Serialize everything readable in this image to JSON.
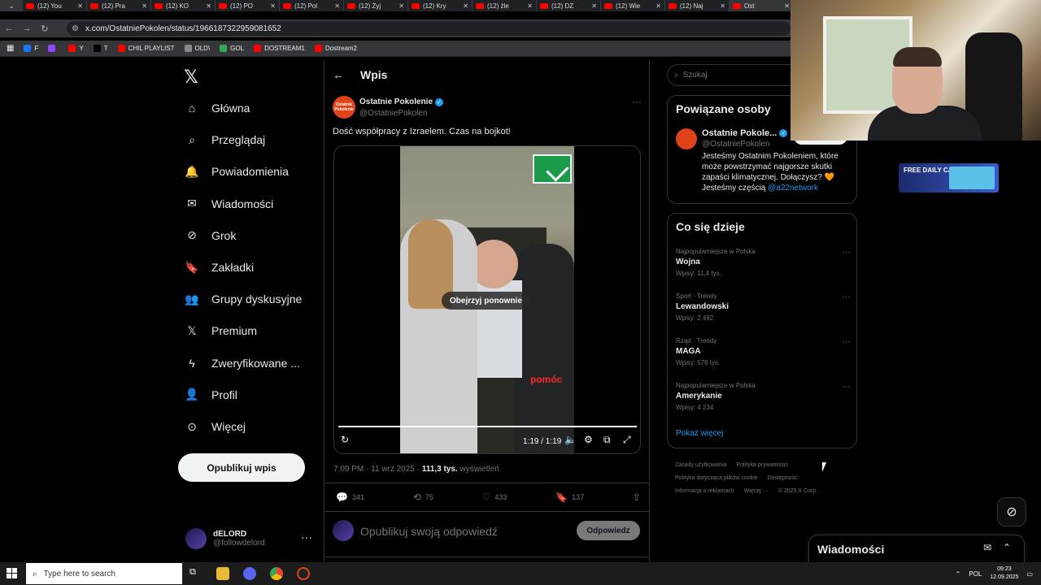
{
  "browser": {
    "tabs": [
      {
        "label": "(12) You"
      },
      {
        "label": "(12) Pra"
      },
      {
        "label": "(12) KO"
      },
      {
        "label": "(12) PO"
      },
      {
        "label": "(12) Pol"
      },
      {
        "label": "(12) Żyj"
      },
      {
        "label": "(12) Kry"
      },
      {
        "label": "(12) źle"
      },
      {
        "label": "(12) DZ"
      },
      {
        "label": "(12) Wie"
      },
      {
        "label": "(12) Naj"
      },
      {
        "label": "Ost"
      }
    ],
    "url": "x.com/OstatniePokolen/status/1966187322959081652",
    "bookmarks": [
      {
        "label": "F",
        "color": "#1877f2"
      },
      {
        "label": "",
        "color": "#9146ff"
      },
      {
        "label": "Y",
        "color": "#ff0000"
      },
      {
        "label": "T",
        "color": "#000000"
      },
      {
        "label": "CHIL PLAYLIST",
        "color": "#ff0000"
      },
      {
        "label": "OLD\\",
        "color": "#8a8a8a"
      },
      {
        "label": "GOL",
        "color": "#34a853"
      },
      {
        "label": "DOSTREAM1",
        "color": "#ff0000"
      },
      {
        "label": "Dostream2",
        "color": "#ff0000"
      }
    ]
  },
  "sidebar": {
    "items": [
      {
        "label": "Główna",
        "icon": "home-icon"
      },
      {
        "label": "Przeglądaj",
        "icon": "search-icon"
      },
      {
        "label": "Powiadomienia",
        "icon": "bell-icon"
      },
      {
        "label": "Wiadomości",
        "icon": "mail-icon"
      },
      {
        "label": "Grok",
        "icon": "grok-icon"
      },
      {
        "label": "Zakładki",
        "icon": "bookmark-icon"
      },
      {
        "label": "Grupy dyskusyjne",
        "icon": "people-icon"
      },
      {
        "label": "Premium",
        "icon": "x-icon"
      },
      {
        "label": "Zweryfikowane ...",
        "icon": "lightning-icon"
      },
      {
        "label": "Profil",
        "icon": "person-icon"
      },
      {
        "label": "Więcej",
        "icon": "more-circle-icon"
      }
    ],
    "post_button": "Opublikuj wpis",
    "user": {
      "name": "dELORD",
      "handle": "@followdelord"
    }
  },
  "post": {
    "header": "Wpis",
    "author_name": "Ostatnie Pokolenie",
    "author_handle": "@OstatniePokolen",
    "avatar_text": "Ostatnie Pokolenie",
    "text": "Dość współpracy z Izraelem. Czas na bojkot!",
    "video": {
      "replay_label": "Obejrzyj ponownie",
      "overlay_text": "pomóc",
      "time": "1:19 / 1:19"
    },
    "meta_time": "7:09 PM · 11 wrz 2025 · ",
    "meta_views": "111,3 tys.",
    "meta_views_label": " wyświetleń",
    "stats": {
      "replies": "341",
      "reposts": "75",
      "likes": "433",
      "bookmarks": "137"
    },
    "reply_placeholder": "Opublikuj swoją odpowiedź",
    "reply_button": "Odpowiedz"
  },
  "right": {
    "search_placeholder": "Szukaj",
    "related": {
      "title": "Powiązane osoby",
      "name": "Ostatnie Pokole...",
      "handle": "@OstatniePokolen",
      "follow": "Obserwuj",
      "bio": "Jesteśmy Ostatnim Pokoleniem, które może powstrzymać najgorsze skutki zapaści klimatycznej. Dołączysz? 🧡 Jesteśmy częścią ",
      "bio_link": "@a22network"
    },
    "trends": {
      "title": "Co się dzieje",
      "items": [
        {
          "context": "Najpopularniejsze w Polska",
          "title": "Wojna",
          "count": "Wpisy: 11,4 tys."
        },
        {
          "context": "Sport · Trendy",
          "title": "Lewandowski",
          "count": "Wpisy: 2 492"
        },
        {
          "context": "Rząd · Trendy",
          "title": "MAGA",
          "count": "Wpisy: 576 tys."
        },
        {
          "context": "Najpopularniejsze w Polska",
          "title": "Amerykanie",
          "count": "Wpisy: 4 234"
        }
      ],
      "show_more": "Pokaż więcej"
    },
    "footer": [
      "Zasady użytkowania",
      "Polityka prywatności",
      "Polityka dotycząca plików cookie",
      "Dostępność",
      "Informacja o reklamach",
      "Więcej ···",
      "© 2025 X Corp."
    ]
  },
  "ad": {
    "text": "FREE DAILY CASE"
  },
  "messages_drawer": {
    "title": "Wiadomości"
  },
  "taskbar": {
    "search_placeholder": "Type here to search",
    "lang": "POL",
    "time": "09:23",
    "date": "12.09.2025"
  }
}
